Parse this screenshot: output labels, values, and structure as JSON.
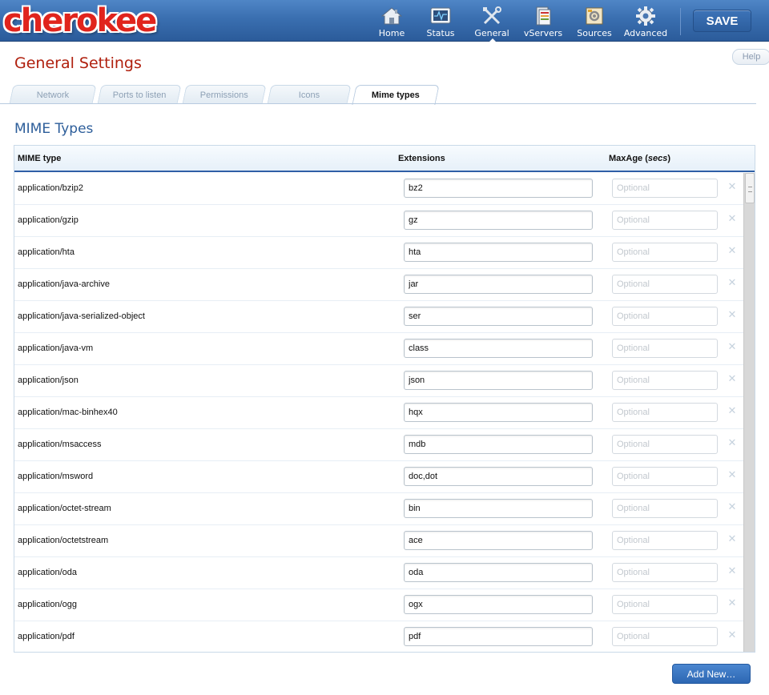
{
  "header": {
    "logo_text": "cherokee",
    "nav": [
      {
        "label": "Home",
        "icon": "home-icon"
      },
      {
        "label": "Status",
        "icon": "status-monitor-icon"
      },
      {
        "label": "General",
        "icon": "tools-icon",
        "active": true
      },
      {
        "label": "vServers",
        "icon": "servers-icon"
      },
      {
        "label": "Sources",
        "icon": "sources-icon"
      },
      {
        "label": "Advanced",
        "icon": "gear-icon"
      }
    ],
    "save_label": "SAVE"
  },
  "page": {
    "title": "General Settings",
    "help_label": "Help"
  },
  "tabs": [
    {
      "label": "Network"
    },
    {
      "label": "Ports to listen"
    },
    {
      "label": "Permissions"
    },
    {
      "label": "Icons"
    },
    {
      "label": "Mime types",
      "active": true
    }
  ],
  "section_title": "MIME Types",
  "table": {
    "col_mime": "MIME type",
    "col_ext": "Extensions",
    "col_maxage": "MaxAge (",
    "col_maxage_unit": "secs",
    "col_maxage_close": ")",
    "maxage_placeholder": "Optional",
    "delete_glyph": "✕",
    "rows": [
      {
        "mime": "application/bzip2",
        "ext": "bz2"
      },
      {
        "mime": "application/gzip",
        "ext": "gz"
      },
      {
        "mime": "application/hta",
        "ext": "hta"
      },
      {
        "mime": "application/java-archive",
        "ext": "jar"
      },
      {
        "mime": "application/java-serialized-object",
        "ext": "ser"
      },
      {
        "mime": "application/java-vm",
        "ext": "class"
      },
      {
        "mime": "application/json",
        "ext": "json"
      },
      {
        "mime": "application/mac-binhex40",
        "ext": "hqx"
      },
      {
        "mime": "application/msaccess",
        "ext": "mdb"
      },
      {
        "mime": "application/msword",
        "ext": "doc,dot"
      },
      {
        "mime": "application/octet-stream",
        "ext": "bin"
      },
      {
        "mime": "application/octetstream",
        "ext": "ace"
      },
      {
        "mime": "application/oda",
        "ext": "oda"
      },
      {
        "mime": "application/ogg",
        "ext": "ogx"
      },
      {
        "mime": "application/pdf",
        "ext": "pdf"
      }
    ]
  },
  "add_new_label": "Add New…",
  "colors": {
    "header_blue": "#3a6fb0",
    "title_red": "#b0200e",
    "section_blue": "#2d5e9a",
    "logo_red": "#e0241d"
  }
}
